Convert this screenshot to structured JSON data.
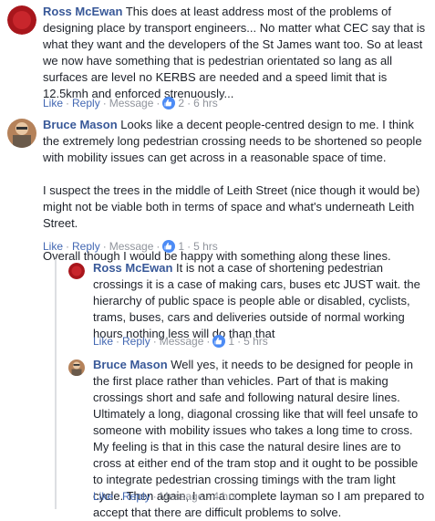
{
  "comments": [
    {
      "author": "Ross McEwan",
      "text": "This does at least address most of the problems of designing place by transport engineers... No matter what CEC say that is what they want and the developers of the St James want too. So at least we now have something that is pedestrian orientated so lang as all surfaces are level no KERBS are needed and a speed limit that is 12.5kmh and enforced strenuously...",
      "actions": {
        "like": "Like",
        "reply": "Reply",
        "message": "Message",
        "reaction_count": "2",
        "time": "6 hrs"
      }
    },
    {
      "author": "Bruce Mason",
      "paragraphs": [
        "Looks like a decent people-centred design to me. I think the extremely long pedestrian crossing needs to be shortened so people with mobility issues can get across in a reasonable space of time.",
        "I suspect the trees in the middle of Leith Street (nice though it would be) might not be viable both in terms of space and what's underneath Leith Street.",
        "Overall though I would be happy with something along these lines."
      ],
      "actions": {
        "like": "Like",
        "reply": "Reply",
        "message": "Message",
        "reaction_count": "1",
        "time": "5 hrs"
      }
    },
    {
      "author": "Ross McEwan",
      "text": "It is not a case of shortening pedestrian crossings it is a case of making cars, buses etc JUST wait. the hierarchy of public space is people able or disabled, cyclists, trams, buses, cars and deliveries outside of normal working hours nothing less will do than that",
      "actions": {
        "like": "Like",
        "reply": "Reply",
        "message": "Message",
        "reaction_count": "1",
        "time": "5 hrs"
      }
    },
    {
      "author": "Bruce Mason",
      "text": "Well yes, it needs to be designed for people in the first place rather than vehicles. Part of that is making crossings short and safe and following natural desire lines. Ultimately a long, diagonal crossing like that will feel unsafe to someone with mobility issues who takes a long time to cross. My feeling is that in this case the natural desire lines are to cross at either end of the tram stop and it ought to be possible to integrate pedestrian crossing timings with the tram light cycle. Then again, I am a complete layman so I am prepared to accept that there are difficult problems to solve.",
      "actions": {
        "like": "Like",
        "reply": "Reply",
        "message": "Message",
        "time": "4 hrs"
      }
    }
  ],
  "colors": {
    "link": "#385898",
    "action": "#4267b2",
    "meta": "#90949c",
    "like_badge": "#4c8bf5"
  },
  "icons": {
    "reaction": "thumbs-up-icon"
  }
}
